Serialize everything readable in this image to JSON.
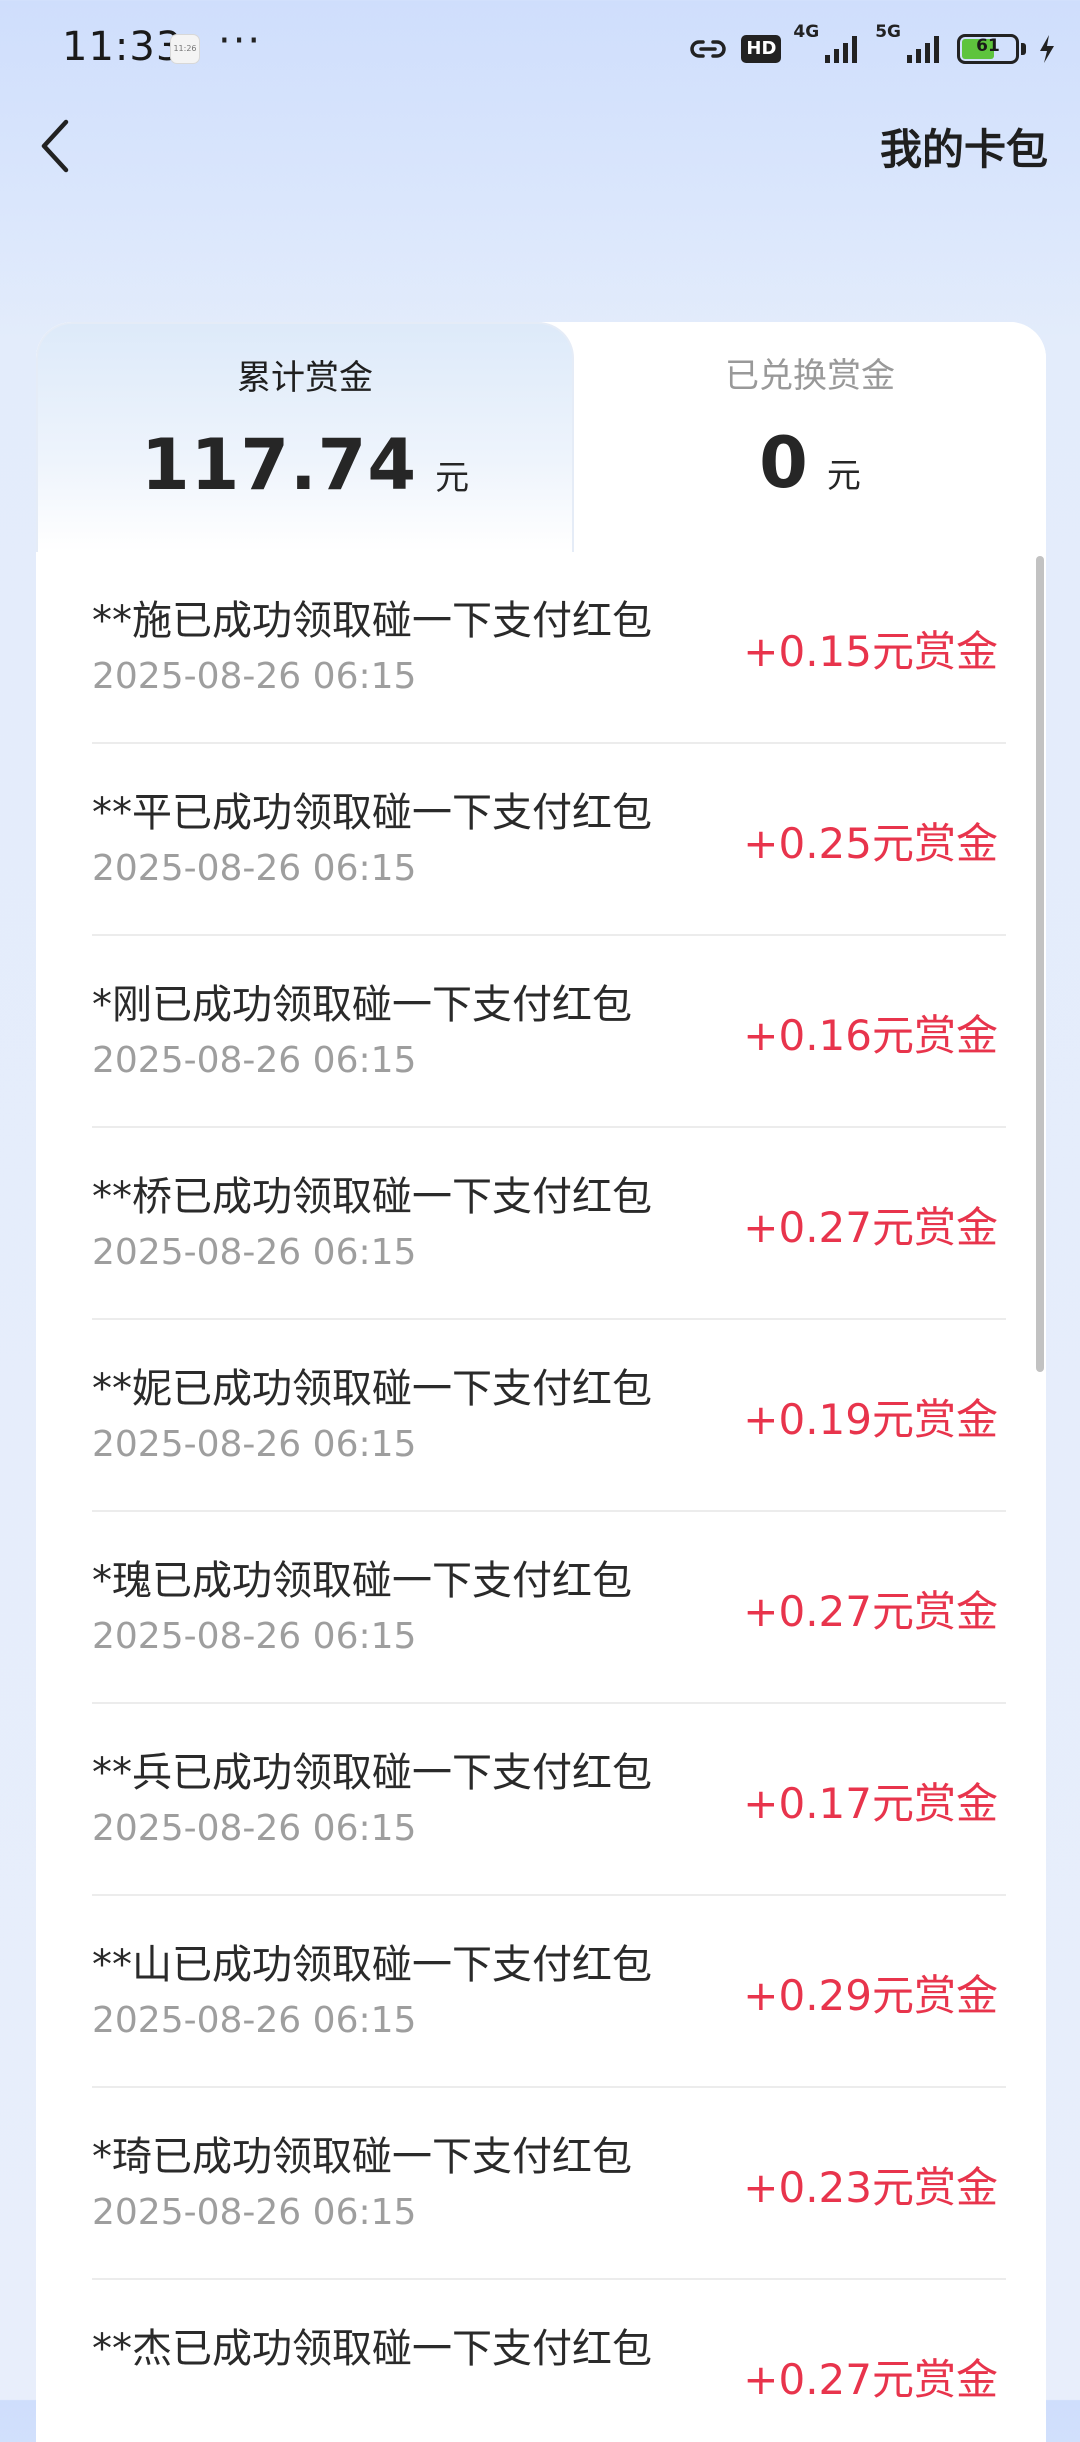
{
  "status_bar": {
    "time": "11:33",
    "mini_icon_text": "11:26",
    "dots": "···",
    "hd_label": "HD",
    "network_1": "4G",
    "network_2": "5G",
    "battery": "61",
    "battery_level": 0.61
  },
  "header": {
    "title": "我的卡包"
  },
  "tabs": [
    {
      "label": "累计赏金",
      "amount": "117.74",
      "unit": "元"
    },
    {
      "label": "已兑换赏金",
      "amount": "0",
      "unit": "元"
    }
  ],
  "records": [
    {
      "title": "**施已成功领取碰一下支付红包",
      "time": "2025-08-26 06:15",
      "amount": "+0.15元赏金"
    },
    {
      "title": "**平已成功领取碰一下支付红包",
      "time": "2025-08-26 06:15",
      "amount": "+0.25元赏金"
    },
    {
      "title": "*刚已成功领取碰一下支付红包",
      "time": "2025-08-26 06:15",
      "amount": "+0.16元赏金"
    },
    {
      "title": "**桥已成功领取碰一下支付红包",
      "time": "2025-08-26 06:15",
      "amount": "+0.27元赏金"
    },
    {
      "title": "**妮已成功领取碰一下支付红包",
      "time": "2025-08-26 06:15",
      "amount": "+0.19元赏金"
    },
    {
      "title": "*瑰已成功领取碰一下支付红包",
      "time": "2025-08-26 06:15",
      "amount": "+0.27元赏金"
    },
    {
      "title": "**兵已成功领取碰一下支付红包",
      "time": "2025-08-26 06:15",
      "amount": "+0.17元赏金"
    },
    {
      "title": "**山已成功领取碰一下支付红包",
      "time": "2025-08-26 06:15",
      "amount": "+0.29元赏金"
    },
    {
      "title": "*琦已成功领取碰一下支付红包",
      "time": "2025-08-26 06:15",
      "amount": "+0.23元赏金"
    },
    {
      "title": "**杰已成功领取碰一下支付红包",
      "time": "",
      "amount": "+0.27元赏金"
    }
  ],
  "colors": {
    "amount_red": "#e8344c",
    "battery_green": "#5ec43d"
  }
}
